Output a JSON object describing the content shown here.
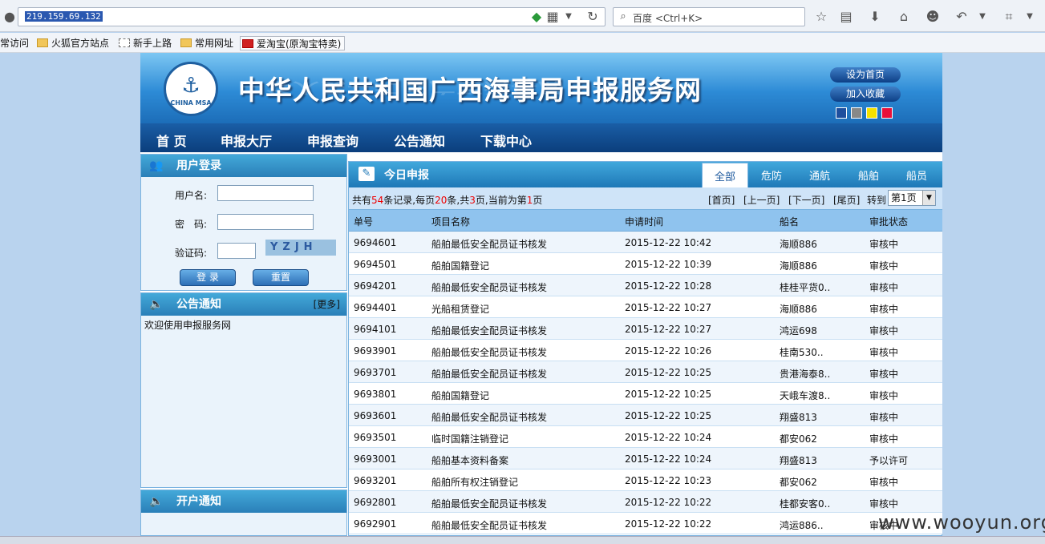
{
  "browser": {
    "url": "219.159.69.132",
    "search_placeholder": "百度 <Ctrl+K>",
    "bookmarks": [
      "常访问",
      "火狐官方站点",
      "新手上路",
      "常用网址",
      "爱淘宝(原淘宝特卖)"
    ]
  },
  "site": {
    "title": "中华人民共和国广西海事局申报服务网",
    "logo_text": "CHINA MSA",
    "set_home_label": "设为首页",
    "add_fav_label": "加入收藏",
    "swatch_colors": [
      "#1e4f9e",
      "#888888",
      "#f5e100",
      "#e8103a"
    ],
    "menu": [
      "首 页",
      "申报大厅",
      "申报查询",
      "公告通知",
      "下载中心"
    ]
  },
  "login": {
    "title": "用户登录",
    "username_label": "用户名:",
    "password_label": "密　码:",
    "captcha_label": "验证码:",
    "captcha_text": "YZJH",
    "login_button": "登 录",
    "reset_button": "重置"
  },
  "notices": {
    "title": "公告通知",
    "more_label": "[更多]",
    "items": [
      "欢迎使用申报服务网"
    ]
  },
  "account_notice": {
    "title": "开户通知"
  },
  "declarations": {
    "title": "今日申报",
    "tabs": [
      "全部",
      "危防",
      "通航",
      "船舶",
      "船员"
    ],
    "active_tab": "全部",
    "pager": {
      "prefix1": "共有",
      "total": "54",
      "prefix2": "条记录,每页",
      "per_page": "20",
      "prefix3": "条,共",
      "pages": "3",
      "prefix4": "页,当前为第",
      "current": "1",
      "suffix": "页",
      "first": "[首页]",
      "prev": "[上一页]",
      "next": "[下一页]",
      "last": "[尾页]",
      "goto_label": "转到",
      "goto_value": "第1页"
    },
    "columns": [
      "单号",
      "项目名称",
      "申请时间",
      "船名",
      "审批状态"
    ],
    "rows": [
      [
        "9694601",
        "船舶最低安全配员证书核发",
        "2015-12-22 10:42",
        "海顺886",
        "审核中"
      ],
      [
        "9694501",
        "船舶国籍登记",
        "2015-12-22 10:39",
        "海顺886",
        "审核中"
      ],
      [
        "9694201",
        "船舶最低安全配员证书核发",
        "2015-12-22 10:28",
        "桂桂平货0..",
        "审核中"
      ],
      [
        "9694401",
        "光船租赁登记",
        "2015-12-22 10:27",
        "海顺886",
        "审核中"
      ],
      [
        "9694101",
        "船舶最低安全配员证书核发",
        "2015-12-22 10:27",
        "鸿运698",
        "审核中"
      ],
      [
        "9693901",
        "船舶最低安全配员证书核发",
        "2015-12-22 10:26",
        "桂南530..",
        "审核中"
      ],
      [
        "9693701",
        "船舶最低安全配员证书核发",
        "2015-12-22 10:25",
        "贵港海泰8..",
        "审核中"
      ],
      [
        "9693801",
        "船舶国籍登记",
        "2015-12-22 10:25",
        "天峨车渡8..",
        "审核中"
      ],
      [
        "9693601",
        "船舶最低安全配员证书核发",
        "2015-12-22 10:25",
        "翔盛813",
        "审核中"
      ],
      [
        "9693501",
        "临时国籍注销登记",
        "2015-12-22 10:24",
        "都安062",
        "审核中"
      ],
      [
        "9693001",
        "船舶基本资料备案",
        "2015-12-22 10:24",
        "翔盛813",
        "予以许可"
      ],
      [
        "9693201",
        "船舶所有权注销登记",
        "2015-12-22 10:23",
        "都安062",
        "审核中"
      ],
      [
        "9692801",
        "船舶最低安全配员证书核发",
        "2015-12-22 10:22",
        "桂都安客0..",
        "审核中"
      ],
      [
        "9692901",
        "船舶最低安全配员证书核发",
        "2015-12-22 10:22",
        "鸿运886..",
        "审核中"
      ]
    ]
  },
  "watermark": "www.wooyun.org"
}
